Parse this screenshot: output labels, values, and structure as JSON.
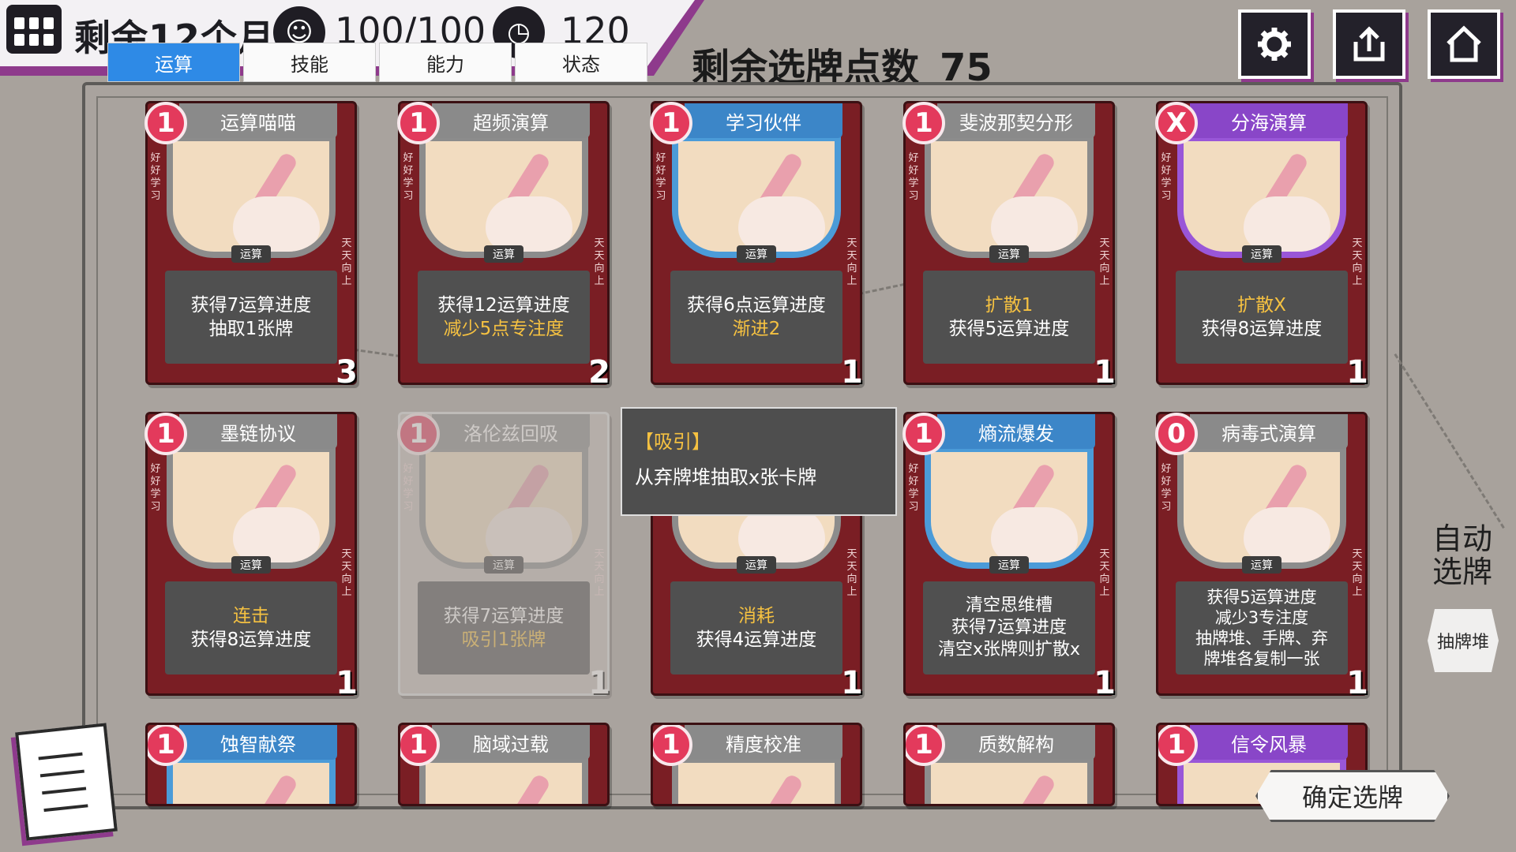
{
  "header": {
    "months_left": "剩余12个月",
    "stat1": "100/100",
    "stat2": "120",
    "remaining_points_label": "剩余选牌点数",
    "remaining_points": "75"
  },
  "tabs": [
    {
      "label": "运算",
      "active": true
    },
    {
      "label": "技能",
      "active": false
    },
    {
      "label": "能力",
      "active": false
    },
    {
      "label": "状态",
      "active": false
    }
  ],
  "top_buttons": [
    "gear-icon",
    "export-icon",
    "home-icon"
  ],
  "cards": [
    {
      "name": "运算喵喵",
      "cost": "1",
      "type": "运算",
      "lines": [
        "获得7运算进度",
        "抽取1张牌"
      ],
      "count": "3",
      "style": "gray"
    },
    {
      "name": "超频演算",
      "cost": "1",
      "type": "运算",
      "lines": [
        "获得12运算进度",
        "减少5点专注度"
      ],
      "count": "2",
      "style": "gray"
    },
    {
      "name": "学习伙伴",
      "cost": "1",
      "type": "运算",
      "lines": [
        "获得6点运算进度",
        "渐进2"
      ],
      "count": "1",
      "style": "blue"
    },
    {
      "name": "斐波那契分形",
      "cost": "1",
      "type": "运算",
      "lines": [
        "扩散1",
        "获得5运算进度"
      ],
      "count": "1",
      "style": "gray"
    },
    {
      "name": "分海演算",
      "cost": "X",
      "type": "运算",
      "lines": [
        "扩散X",
        "获得8运算进度"
      ],
      "count": "1",
      "style": "purple"
    },
    {
      "name": "墨链协议",
      "cost": "1",
      "type": "运算",
      "lines": [
        "连击",
        "获得8运算进度"
      ],
      "count": "1",
      "style": "gray"
    },
    {
      "name": "洛伦兹回吸",
      "cost": "1",
      "type": "运算",
      "lines": [
        "获得7运算进度",
        "吸引1张牌"
      ],
      "count": "1",
      "style": "gray",
      "faded": true
    },
    {
      "name": "",
      "cost": "",
      "type": "运算",
      "lines": [
        "消耗",
        "获得4运算进度"
      ],
      "count": "1",
      "style": "gray"
    },
    {
      "name": "熵流爆发",
      "cost": "1",
      "type": "运算",
      "lines": [
        "清空思维槽",
        "获得7运算进度",
        "清空x张牌则扩散x"
      ],
      "count": "1",
      "style": "blue"
    },
    {
      "name": "病毒式演算",
      "cost": "0",
      "type": "运算",
      "lines": [
        "获得5运算进度",
        "减少3专注度",
        "抽牌堆、手牌、弃",
        "牌堆各复制一张"
      ],
      "count": "1",
      "style": "gray"
    },
    {
      "name": "蚀智献祭",
      "cost": "1",
      "style": "blue"
    },
    {
      "name": "脑域过载",
      "cost": "1",
      "style": "gray"
    },
    {
      "name": "精度校准",
      "cost": "1",
      "style": "gray"
    },
    {
      "name": "质数解构",
      "cost": "1",
      "style": "gray"
    },
    {
      "name": "信令风暴",
      "cost": "1",
      "style": "purple"
    }
  ],
  "side_text": {
    "left": "好好学习",
    "right": "天天向上"
  },
  "keywords": [
    "专注度",
    "渐进2",
    "扩散1",
    "扩散X",
    "连击",
    "吸引",
    "消耗",
    "扩散"
  ],
  "tooltip": {
    "title": "【吸引】",
    "body": "从弃牌堆抽取x张卡牌"
  },
  "right_panel": {
    "auto_pick": "自动选牌",
    "draw_pile": "抽牌堆"
  },
  "confirm_button": "确定选牌",
  "colors": {
    "accent_purple": "#8e3a8c",
    "tab_active": "#2e8ae6",
    "card_body": "#7a1e24",
    "cost_badge": "#e33a5c",
    "keyword": "#f5c141"
  }
}
